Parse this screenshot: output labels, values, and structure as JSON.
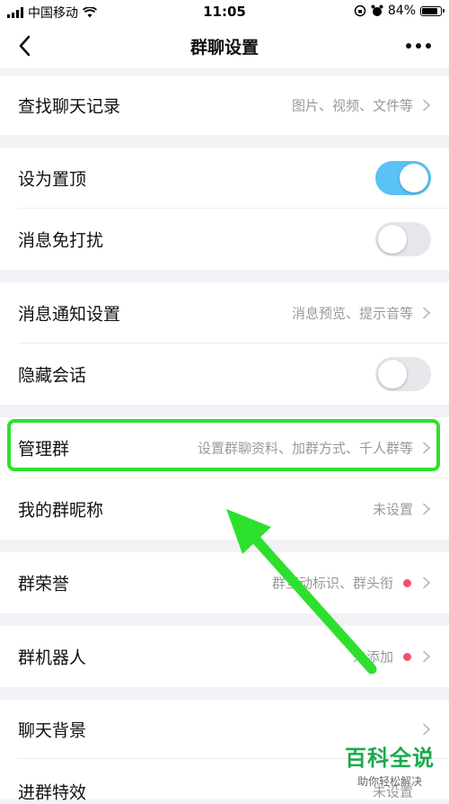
{
  "status_bar": {
    "carrier": "中国移动",
    "time": "11:05",
    "battery": "84%"
  },
  "nav": {
    "title": "群聊设置"
  },
  "rows": {
    "search_history": {
      "label": "查找聊天记录",
      "hint": "图片、视频、文件等"
    },
    "pin_top": {
      "label": "设为置顶",
      "toggle": true
    },
    "do_not_disturb": {
      "label": "消息免打扰",
      "toggle": false
    },
    "notification_settings": {
      "label": "消息通知设置",
      "hint": "消息预览、提示音等"
    },
    "hide_chat": {
      "label": "隐藏会话",
      "toggle": false
    },
    "manage_group": {
      "label": "管理群",
      "hint": "设置群聊资料、加群方式、千人群等"
    },
    "my_nickname": {
      "label": "我的群昵称",
      "hint": "未设置"
    },
    "group_honor": {
      "label": "群荣誉",
      "hint": "群互动标识、群头衔"
    },
    "group_robot": {
      "label": "群机器人",
      "hint": "未添加"
    },
    "chat_background": {
      "label": "聊天背景"
    },
    "entry_effect": {
      "label": "进群特效",
      "hint": "未设置"
    }
  },
  "watermark": {
    "title": "百科全说",
    "subtitle": "助你轻松解决"
  },
  "colors": {
    "toggle_on": "#5ac2f4",
    "highlight": "#2ee02e",
    "red_dot": "#f0536b"
  }
}
